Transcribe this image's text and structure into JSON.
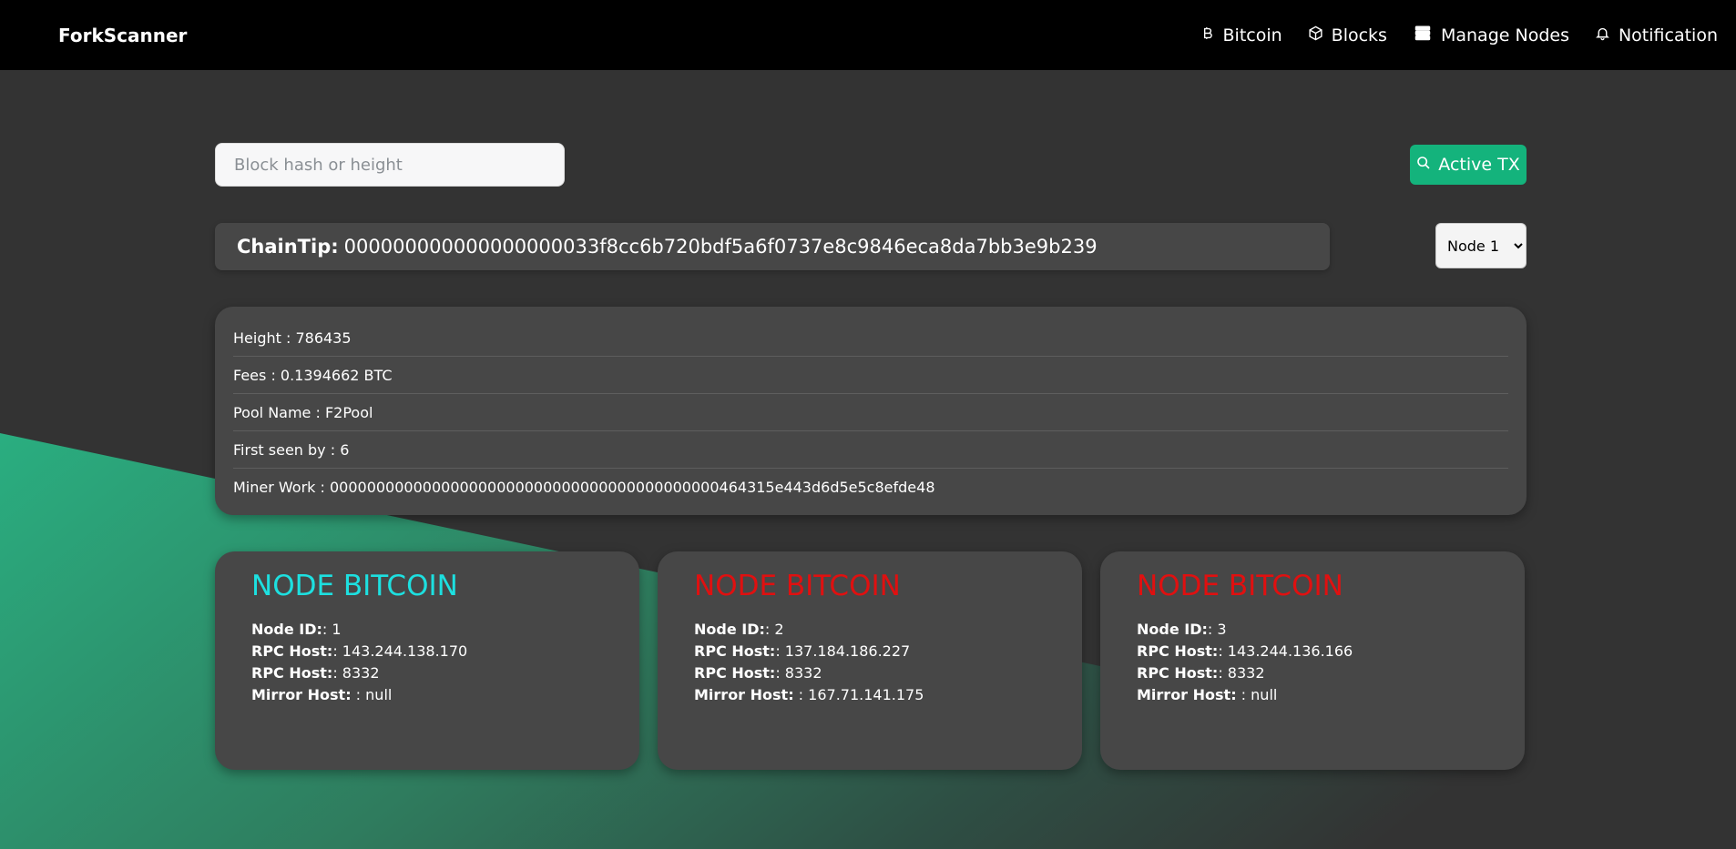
{
  "colors": {
    "accent_green": "#14b37c",
    "node_active": "#1de0e0",
    "node_inactive": "#e01010",
    "navbar_bg": "#000000",
    "card_bg": "#474747"
  },
  "navbar": {
    "brand": "ForkScanner",
    "links": [
      {
        "label": "Bitcoin",
        "icon": "bitcoin-icon"
      },
      {
        "label": "Blocks",
        "icon": "cube-icon"
      },
      {
        "label": "Manage Nodes",
        "icon": "server-icon"
      },
      {
        "label": "Notification",
        "icon": "bell-icon"
      }
    ]
  },
  "search": {
    "placeholder": "Block hash or height",
    "button_label": "Active TX"
  },
  "chaintip": {
    "label": "ChainTip:",
    "value": "000000000000000000033f8cc6b720bdf5a6f0737e8c9846eca8da7bb3e9b239"
  },
  "node_select": {
    "selected": "Node 1"
  },
  "block_info": [
    "Height : 786435",
    "Fees : 0.1394662 BTC",
    "Pool Name : F2Pool",
    "First seen by : 6",
    "Miner Work : 000000000000000000000000000000000000000000464315e443d6d5e5c8efde48"
  ],
  "nodes": [
    {
      "title": "NODE BITCOIN",
      "status": "active",
      "id_label": "Node ID:",
      "id_value": ": 1",
      "rpc_host_label": "RPC Host:",
      "rpc_host_value": ": 143.244.138.170",
      "rpc_port_label": "RPC Host:",
      "rpc_port_value": ": 8332",
      "mirror_label": "Mirror Host:",
      "mirror_value": " : null"
    },
    {
      "title": "NODE BITCOIN",
      "status": "inactive",
      "id_label": "Node ID:",
      "id_value": ": 2",
      "rpc_host_label": "RPC Host:",
      "rpc_host_value": ": 137.184.186.227",
      "rpc_port_label": "RPC Host:",
      "rpc_port_value": ": 8332",
      "mirror_label": "Mirror Host:",
      "mirror_value": " : 167.71.141.175"
    },
    {
      "title": "NODE BITCOIN",
      "status": "inactive",
      "id_label": "Node ID:",
      "id_value": ": 3",
      "rpc_host_label": "RPC Host:",
      "rpc_host_value": ": 143.244.136.166",
      "rpc_port_label": "RPC Host:",
      "rpc_port_value": ": 8332",
      "mirror_label": "Mirror Host:",
      "mirror_value": " : null"
    }
  ]
}
